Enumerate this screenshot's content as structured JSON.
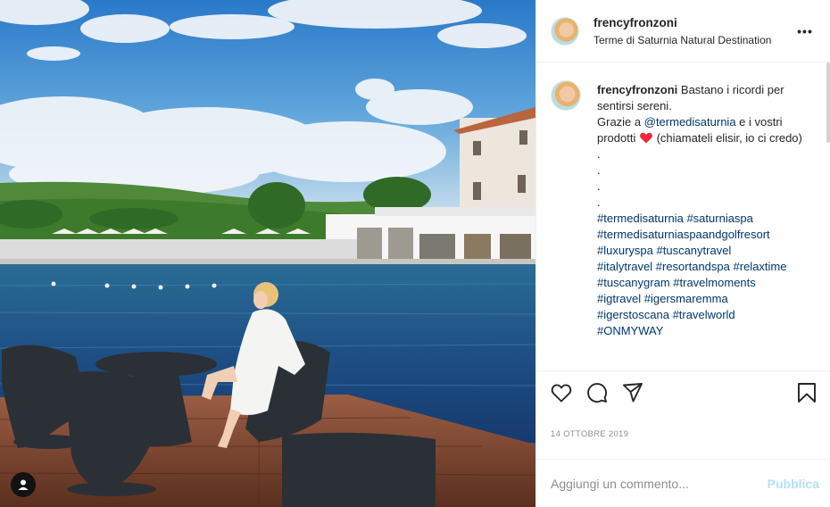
{
  "header": {
    "username": "frencyfronzoni",
    "location": "Terme di Saturnia Natural Destination",
    "more_icon": "more-horizontal-icon",
    "more_label": "•••"
  },
  "caption": {
    "username": "frencyfronzoni",
    "line1": " Bastano i ricordi per sentirsi sereni.",
    "grazie": "Grazie a ",
    "mention": "@termedisaturnia",
    "after_mention": " e i vostri prodotti ",
    "heart_icon": "red-heart-emoji",
    "after_heart": " (chiamateli elisir, io ci credo)",
    "dots": [
      ".",
      ".",
      ".",
      "."
    ],
    "hashtags": [
      "#termedisaturnia",
      "#saturniaspa",
      "#termedisaturniaspaandgolfresort",
      "#luxuryspa",
      "#tuscanytravel",
      "#italytravel",
      "#resortandspa",
      "#relaxtime",
      "#tuscanygram",
      "#travelmoments",
      "#igtravel",
      "#igersmaremma",
      "#igerstoscana",
      "#travelworld",
      "#ONMYWAY"
    ]
  },
  "actions": {
    "like_icon": "heart-outline-icon",
    "comment_icon": "comment-icon",
    "share_icon": "paper-plane-icon",
    "save_icon": "bookmark-icon"
  },
  "date": "14 OTTOBRE 2019",
  "add_comment": {
    "placeholder": "Aggiungi un commento...",
    "publish_label": "Pubblica"
  },
  "photo": {
    "user_tag_icon": "user-tag-icon"
  },
  "colors": {
    "link": "#00376b",
    "publish_disabled": "#b2dffc",
    "heart": "#ed4956",
    "border": "#efefef"
  }
}
